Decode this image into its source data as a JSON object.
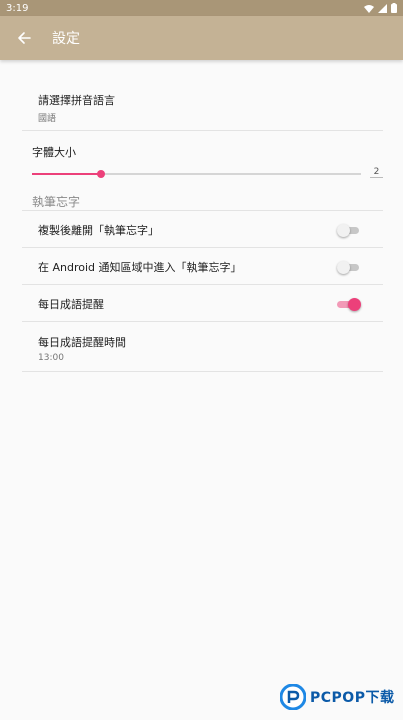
{
  "status_bar": {
    "time": "3:19",
    "icons": [
      "wifi-icon",
      "signal-icon",
      "battery-icon"
    ]
  },
  "app_bar": {
    "title": "設定",
    "back_icon": "arrow-left-icon"
  },
  "language_pref": {
    "title": "請選擇拼音語言",
    "summary": "國語"
  },
  "font_size": {
    "title": "字體大小",
    "value": "2",
    "level_fraction": 0.21
  },
  "section": {
    "title": "執筆忘字"
  },
  "toggles": [
    {
      "label": "複製後離開「執筆忘字」",
      "on": false
    },
    {
      "label": "在 Android 通知區域中進入「執筆忘字」",
      "on": false
    },
    {
      "label": "每日成語提醒",
      "on": true
    }
  ],
  "reminder_time": {
    "title": "每日成語提醒時間",
    "summary": "13:00"
  },
  "watermark": {
    "text": "PCPOP下载"
  },
  "colors": {
    "accent": "#ec407a",
    "app_bar": "#c4b295",
    "status_bar": "#a99677"
  }
}
